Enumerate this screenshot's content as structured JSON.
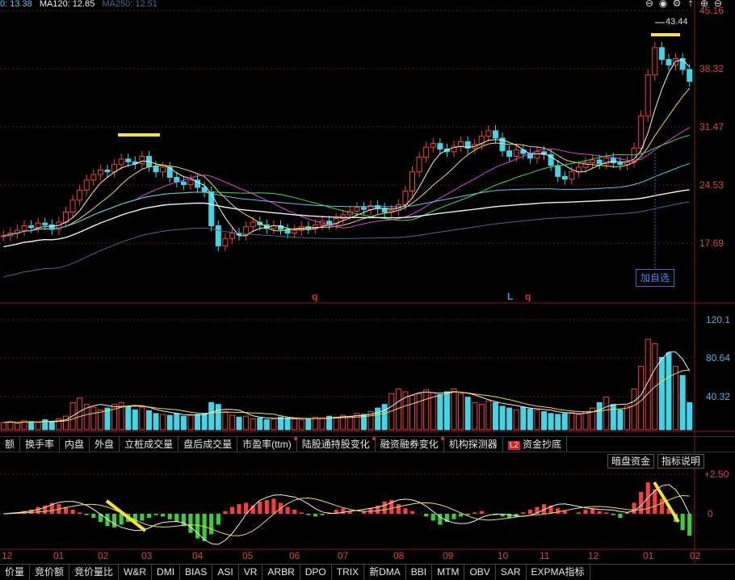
{
  "ma_legend": [
    {
      "label": "0: 13.38",
      "color": "#55c8f0"
    },
    {
      "label": "MA120: 12.85",
      "color": "#f0f0f0"
    },
    {
      "label": "MA250: 12.51",
      "color": "#3a6f9a"
    }
  ],
  "toolbar": {
    "icons": [
      "lock-icon",
      "eye-icon",
      "settings-icon",
      "collapse-icon",
      "zoom-in-icon",
      "zoom-out-icon"
    ],
    "glyphs": [
      "⊖",
      "◉",
      "⚙",
      "⤒",
      "⊕",
      "⊖"
    ]
  },
  "price_axis": [
    "45.16",
    "38.32",
    "31.47",
    "24.53",
    "17.69"
  ],
  "max_price_label": "43.44",
  "add_favorite_label": "加自选",
  "markers": [
    "q",
    "L",
    "q"
  ],
  "volume_axis": [
    "120.1",
    "80.64",
    "40.32"
  ],
  "indicator_tabs": [
    {
      "label": "额",
      "dot": false
    },
    {
      "label": "换手率",
      "dot": false
    },
    {
      "label": "内盘",
      "dot": false
    },
    {
      "label": "外盘",
      "dot": false
    },
    {
      "label": "立桩成交量",
      "dot": false
    },
    {
      "label": "盘后成交量",
      "dot": false
    },
    {
      "label": "市盈率(ttm)",
      "dot": true
    },
    {
      "label": "陆股通持股变化",
      "dot": true
    },
    {
      "label": "融资融券变化",
      "dot": true
    },
    {
      "label": "机构探测器",
      "dot": false
    },
    {
      "label": "资金抄底",
      "dot": false,
      "badge": "L2"
    }
  ],
  "panel_buttons": [
    "暗盘资金",
    "指标说明"
  ],
  "macd_axis": [
    "+2.50",
    "0"
  ],
  "months": [
    "12",
    "01",
    "02",
    "03",
    "04",
    "05",
    "06",
    "07",
    "08",
    "09",
    "10",
    "11",
    "12",
    "01",
    "02"
  ],
  "bottom_tabs": [
    "价量",
    "竞价额",
    "竞价量比",
    "W&R",
    "DMI",
    "BIAS",
    "ASI",
    "VR",
    "ARBR",
    "DPO",
    "TRIX",
    "新DMA",
    "BBI",
    "MTM",
    "OBV",
    "SAR",
    "EXPMA指标"
  ],
  "chart_data": {
    "type": "candlestick",
    "price_range": [
      14.0,
      46.0
    ],
    "closes": [
      20.9,
      21.2,
      21.5,
      22.0,
      21.8,
      22.3,
      22.1,
      21.6,
      22.4,
      23.5,
      24.8,
      25.9,
      27.0,
      27.6,
      28.1,
      27.9,
      28.7,
      29.3,
      29.0,
      28.8,
      29.6,
      28.5,
      27.9,
      28.4,
      27.3,
      26.8,
      26.5,
      27.0,
      26.2,
      25.7,
      22.0,
      19.8,
      20.6,
      21.2,
      21.0,
      21.9,
      22.4,
      22.1,
      21.7,
      22.0,
      21.6,
      21.2,
      21.5,
      21.9,
      21.7,
      22.1,
      22.5,
      22.2,
      22.8,
      23.2,
      23.6,
      24.0,
      23.8,
      24.2,
      23.9,
      23.5,
      23.7,
      24.3,
      25.8,
      27.9,
      29.5,
      30.6,
      31.0,
      30.4,
      30.1,
      30.7,
      31.2,
      30.5,
      30.9,
      31.8,
      32.4,
      31.6,
      30.2,
      29.6,
      30.3,
      29.9,
      29.4,
      30.1,
      29.8,
      28.6,
      27.4,
      27.1,
      27.9,
      28.4,
      28.9,
      29.2,
      28.8,
      29.4,
      28.9,
      28.7,
      29.0,
      30.5,
      34.0,
      38.5,
      41.5,
      40.2,
      39.6,
      40.3,
      39.1,
      37.8
    ],
    "volume_range": [
      0,
      125
    ],
    "volumes": [
      8,
      9,
      7,
      10,
      9,
      8,
      11,
      9,
      12,
      15,
      30,
      35,
      28,
      25,
      22,
      24,
      28,
      30,
      26,
      22,
      25,
      21,
      18,
      17,
      16,
      18,
      15,
      16,
      17,
      18,
      30,
      28,
      20,
      16,
      14,
      15,
      12,
      13,
      11,
      12,
      14,
      13,
      12,
      11,
      12,
      14,
      13,
      15,
      14,
      16,
      15,
      18,
      17,
      20,
      24,
      28,
      40,
      45,
      42,
      38,
      40,
      44,
      41,
      39,
      42,
      45,
      40,
      36,
      30,
      28,
      32,
      30,
      26,
      24,
      22,
      25,
      23,
      22,
      20,
      18,
      17,
      18,
      19,
      17,
      20,
      24,
      30,
      36,
      28,
      22,
      26,
      45,
      70,
      100,
      95,
      80,
      85,
      70,
      60,
      30
    ],
    "macd_range": [
      -4.0,
      3.8
    ],
    "macd_hist": [
      0.0,
      0.05,
      0.1,
      0.2,
      0.3,
      0.5,
      0.6,
      0.8,
      0.7,
      0.5,
      0.3,
      0.1,
      -0.1,
      -0.3,
      -0.6,
      -0.9,
      -1.0,
      -0.8,
      -0.6,
      -0.7,
      -0.5,
      -0.3,
      -0.1,
      -0.2,
      -0.4,
      -0.6,
      -0.9,
      -1.4,
      -1.8,
      -2.0,
      -1.5,
      -0.8,
      0.2,
      0.5,
      0.7,
      0.8,
      0.6,
      0.9,
      1.0,
      1.1,
      0.8,
      0.5,
      0.3,
      0.1,
      -0.1,
      -0.2,
      -0.1,
      0.1,
      0.3,
      0.4,
      0.2,
      0.0,
      0.2,
      0.4,
      0.6,
      0.9,
      1.0,
      0.7,
      0.4,
      0.2,
      0.0,
      -0.2,
      -0.5,
      -0.8,
      -0.6,
      -0.4,
      -0.2,
      -0.1,
      0.1,
      0.2,
      0.0,
      -0.1,
      -0.2,
      -0.3,
      -0.2,
      0.1,
      0.3,
      0.5,
      0.7,
      0.6,
      0.4,
      0.2,
      0.0,
      0.1,
      0.3,
      0.4,
      0.2,
      0.1,
      -0.1,
      -0.3,
      0.1,
      0.8,
      1.6,
      2.3,
      1.8,
      1.1,
      0.4,
      -0.6,
      -1.2,
      -1.6
    ]
  }
}
